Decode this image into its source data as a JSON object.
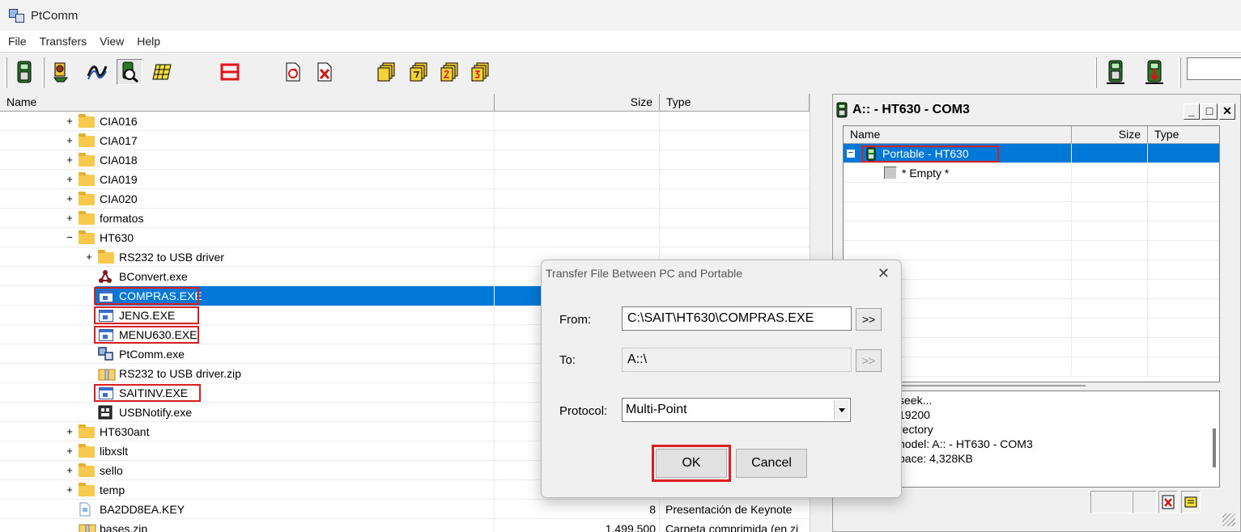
{
  "window": {
    "title": "PtComm"
  },
  "menu": [
    "File",
    "Transfers",
    "View",
    "Help"
  ],
  "toolbar": {
    "buttons": [
      "portable-icon",
      "connect-icon",
      "signal-icon",
      "find-portable-icon",
      "grid-icon",
      "split-icon",
      "refresh-icon",
      "delete-icon",
      "file-group-1-icon",
      "file-group-7-icon",
      "file-group-2-icon",
      "file-group-3-icon",
      "send-icon",
      "receive-icon"
    ],
    "input_value": ""
  },
  "left_pane": {
    "columns": {
      "name": "Name",
      "size": "Size",
      "type": "Type"
    },
    "rows": [
      {
        "expander": "+",
        "kind": "folder",
        "name": "CIA016",
        "size": "",
        "type": ""
      },
      {
        "expander": "+",
        "kind": "folder",
        "name": "CIA017",
        "size": "",
        "type": ""
      },
      {
        "expander": "+",
        "kind": "folder",
        "name": "CIA018",
        "size": "",
        "type": ""
      },
      {
        "expander": "+",
        "kind": "folder",
        "name": "CIA019",
        "size": "",
        "type": ""
      },
      {
        "expander": "+",
        "kind": "folder",
        "name": "CIA020",
        "size": "",
        "type": ""
      },
      {
        "expander": "+",
        "kind": "folder",
        "name": "formatos",
        "size": "",
        "type": ""
      },
      {
        "expander": "−",
        "kind": "folder",
        "name": "HT630",
        "size": "",
        "type": ""
      },
      {
        "expander": "+",
        "kind": "folder",
        "name": "RS232 to USB driver",
        "size": "",
        "type": ""
      },
      {
        "expander": "",
        "kind": "app",
        "name": "BConvert.exe",
        "size": "",
        "type": ""
      },
      {
        "expander": "",
        "kind": "exe",
        "name": "COMPRAS.EXE",
        "size": "",
        "type": ""
      },
      {
        "expander": "",
        "kind": "exe",
        "name": "JENG.EXE",
        "size": "",
        "type": ""
      },
      {
        "expander": "",
        "kind": "exe",
        "name": "MENU630.EXE",
        "size": "",
        "type": ""
      },
      {
        "expander": "",
        "kind": "ptcomm",
        "name": "PtComm.exe",
        "size": "",
        "type": ""
      },
      {
        "expander": "",
        "kind": "zip",
        "name": "RS232 to USB driver.zip",
        "size": "",
        "type": ""
      },
      {
        "expander": "",
        "kind": "exe",
        "name": "SAITINV.EXE",
        "size": "",
        "type": ""
      },
      {
        "expander": "",
        "kind": "usb",
        "name": "USBNotify.exe",
        "size": "",
        "type": ""
      },
      {
        "expander": "+",
        "kind": "folder",
        "name": "HT630ant",
        "size": "",
        "type": ""
      },
      {
        "expander": "+",
        "kind": "folder",
        "name": "libxslt",
        "size": "",
        "type": ""
      },
      {
        "expander": "+",
        "kind": "folder",
        "name": "sello",
        "size": "",
        "type": ""
      },
      {
        "expander": "+",
        "kind": "folder",
        "name": "temp",
        "size": "",
        "type": ""
      },
      {
        "expander": "",
        "kind": "key",
        "name": "BA2DD8EA.KEY",
        "size": "8",
        "type": "Presentación de Keynote"
      },
      {
        "expander": "",
        "kind": "zip",
        "name": "bases.zip",
        "size": "1.499.500",
        "type": "Carpeta comprimida (en zi"
      }
    ]
  },
  "portable_window": {
    "title": "A:: - HT630 - COM3",
    "controls": {
      "minimize": "_",
      "maximize": "□",
      "close": "✕"
    },
    "columns": {
      "name": "Name",
      "size": "Size",
      "type": "Type"
    },
    "root": {
      "expander": "−",
      "name": "Portable - HT630"
    },
    "child": {
      "name": "* Empty *"
    },
    "log": [
      "seek...",
      "19200",
      "rectory",
      "nodel: A:: - HT630 - COM3",
      "pace: 4,328KB"
    ]
  },
  "dialog": {
    "title": "Transfer File Between PC and Portable",
    "close": "✕",
    "from_label": "From:",
    "from_value": "C:\\SAIT\\HT630\\COMPRAS.EXE",
    "to_label": "To:",
    "to_value": "A::\\",
    "browse_label": ">>",
    "protocol_label": "Protocol:",
    "protocol_value": "Multi-Point",
    "ok_label": "OK",
    "cancel_label": "Cancel"
  },
  "colors": {
    "selection": "#0078d7",
    "highlight_box": "#d9201f",
    "folder": "#f8c94c"
  }
}
